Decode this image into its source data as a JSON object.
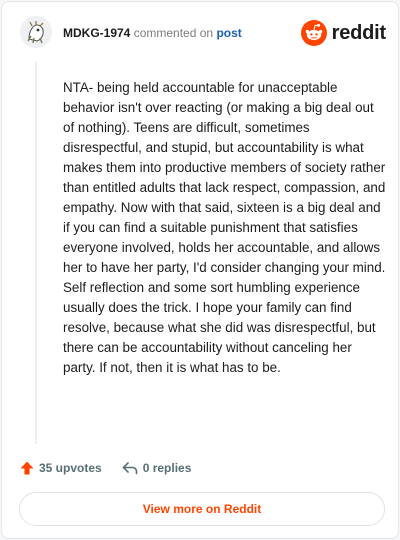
{
  "comment": {
    "author": "MDKG-1974",
    "action_text": "commented on",
    "post_link_label": "post",
    "body": "NTA- being held accountable for unacceptable behavior isn't over reacting (or making a big deal out of nothing). Teens are difficult, sometimes disrespectful, and stupid, but accountability is what makes them into productive members of society rather than entitled adults that lack respect, compassion, and empathy. Now with that said, sixteen is a big deal and if you can find a suitable punishment that satisfies everyone involved, holds her accountable, and allows her to have her party, I'd consider changing your mind. Self reflection and some sort humbling experience usually does the trick. I hope your family can find resolve, because what she did was disrespectful, but there can be accountability without canceling her party. If not, then it is what has to be.",
    "upvotes_label": "35 upvotes",
    "replies_label": "0 replies"
  },
  "brand": {
    "name": "reddit",
    "logo_icon": "reddit-snoo-icon",
    "accent_color": "#ff4500"
  },
  "actions": {
    "view_more_label": "View more on Reddit"
  },
  "icons": {
    "upvote": "arrow-up-icon",
    "reply": "reply-arrow-icon",
    "avatar": "user-avatar"
  }
}
